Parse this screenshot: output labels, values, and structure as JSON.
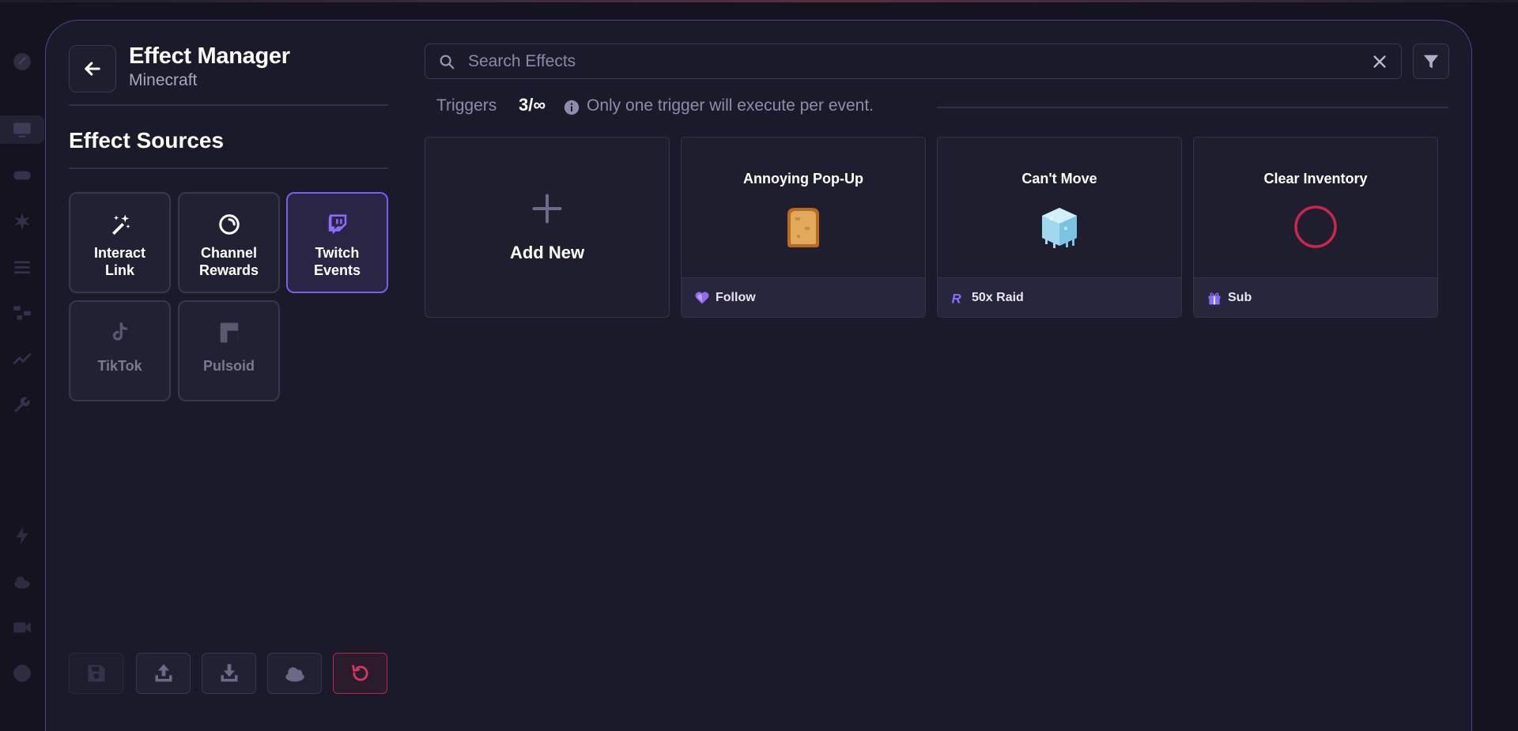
{
  "header": {
    "title": "Effect Manager",
    "subtitle": "Minecraft",
    "back_label": "Back"
  },
  "sources": {
    "heading": "Effect Sources",
    "items": [
      {
        "label_line1": "Interact",
        "label_line2": "Link",
        "icon": "magic-wand-icon",
        "state": "normal"
      },
      {
        "label_line1": "Channel",
        "label_line2": "Rewards",
        "icon": "channel-points-icon",
        "state": "normal"
      },
      {
        "label_line1": "Twitch",
        "label_line2": "Events",
        "icon": "twitch-icon",
        "state": "selected"
      },
      {
        "label_line1": "TikTok",
        "label_line2": "",
        "icon": "tiktok-icon",
        "state": "disabled"
      },
      {
        "label_line1": "Pulsoid",
        "label_line2": "",
        "icon": "pulsoid-icon",
        "state": "disabled"
      }
    ]
  },
  "search": {
    "placeholder": "Search Effects",
    "value": ""
  },
  "triggers": {
    "label": "Triggers",
    "count": "3/∞",
    "note": "Only one trigger will execute per event."
  },
  "add_card": {
    "label": "Add New"
  },
  "effects": [
    {
      "name": "Annoying Pop-Up",
      "image": "toast-image",
      "trigger": "Follow",
      "trigger_icon": "heart-icon"
    },
    {
      "name": "Can't Move",
      "image": "ice-block-image",
      "trigger": "50x Raid",
      "trigger_icon": "raid-icon"
    },
    {
      "name": "Clear Inventory",
      "image": "empty-circle-image",
      "trigger": "Sub",
      "trigger_icon": "gift-icon"
    }
  ],
  "bottom_toolbar": {
    "buttons": [
      {
        "name": "save-button",
        "icon": "save-icon",
        "state": "disabled"
      },
      {
        "name": "upload-button",
        "icon": "upload-icon",
        "state": "normal"
      },
      {
        "name": "download-button",
        "icon": "download-icon",
        "state": "normal"
      },
      {
        "name": "cloud-button",
        "icon": "cloud-icon",
        "state": "normal"
      },
      {
        "name": "reset-button",
        "icon": "reset-icon",
        "state": "danger"
      }
    ]
  },
  "colors": {
    "accent": "#7a5cf0",
    "modal_border": "#4c4394",
    "danger": "#d63760",
    "background": "#14131f",
    "panel": "#1b1a2a"
  }
}
